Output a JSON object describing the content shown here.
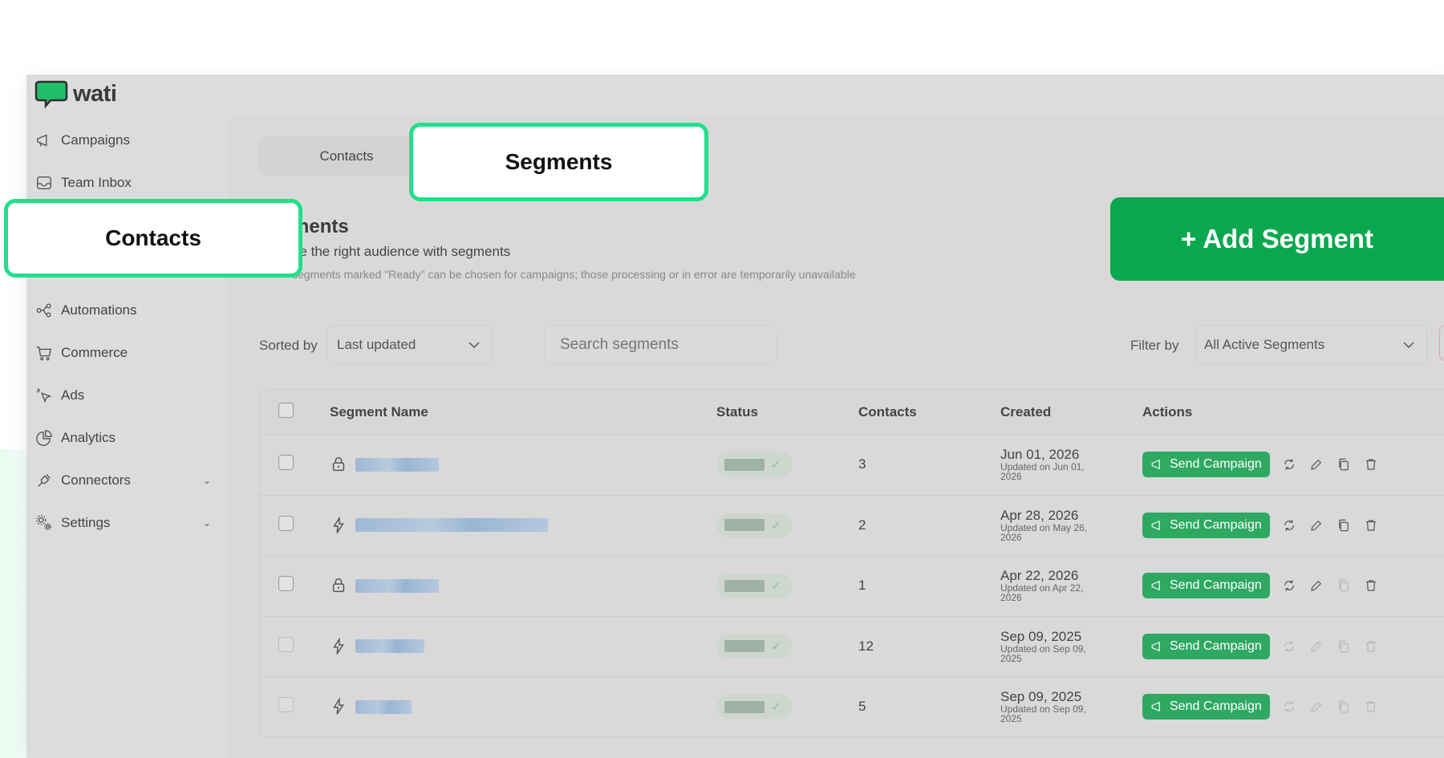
{
  "brand": {
    "name": "wati"
  },
  "sidebar": {
    "items": [
      {
        "label": "Campaigns",
        "icon": "megaphone-icon"
      },
      {
        "label": "Team Inbox",
        "icon": "inbox-icon"
      },
      {
        "label": "Automations",
        "icon": "flow-icon"
      },
      {
        "label": "Commerce",
        "icon": "cart-icon"
      },
      {
        "label": "Ads",
        "icon": "cursor-click-icon"
      },
      {
        "label": "Analytics",
        "icon": "pie-chart-icon"
      },
      {
        "label": "Connectors",
        "icon": "plug-icon"
      },
      {
        "label": "Settings",
        "icon": "gear-icon"
      }
    ]
  },
  "tabs": {
    "contacts": "Contacts",
    "segments": "Segments"
  },
  "page": {
    "heading": "ments",
    "subheading": "ge the right audience with segments",
    "note": "segments marked \"Ready\" can be chosen for campaigns; those processing or in error are temporarily unavailable"
  },
  "controls": {
    "sort_label": "Sorted by",
    "sort_value": "Last updated",
    "search_placeholder": "Search segments",
    "filter_label": "Filter by",
    "filter_value": "All Active Segments"
  },
  "table": {
    "headers": {
      "name": "Segment Name",
      "status": "Status",
      "contacts": "Contacts",
      "created": "Created",
      "actions": "Actions"
    },
    "action_label": "Send Campaign",
    "rows": [
      {
        "contacts": "3",
        "created": "Jun 01, 2026",
        "updated": "Updated on Jun 01, 2026"
      },
      {
        "contacts": "2",
        "created": "Apr 28, 2026",
        "updated": "Updated on May 26, 2026"
      },
      {
        "contacts": "1",
        "created": "Apr 22, 2026",
        "updated": "Updated on Apr 22, 2026"
      },
      {
        "contacts": "12",
        "created": "Sep 09, 2025",
        "updated": "Updated on Sep 09, 2025"
      },
      {
        "contacts": "5",
        "created": "Sep 09, 2025",
        "updated": "Updated on Sep 09, 2025"
      }
    ]
  },
  "callouts": {
    "segments": "Segments",
    "contacts": "Contacts",
    "add_segment": "+ Add Segment"
  },
  "colors": {
    "accent": "#20e08a",
    "brand_green": "#0aa84e",
    "button_green": "#2fa862"
  }
}
